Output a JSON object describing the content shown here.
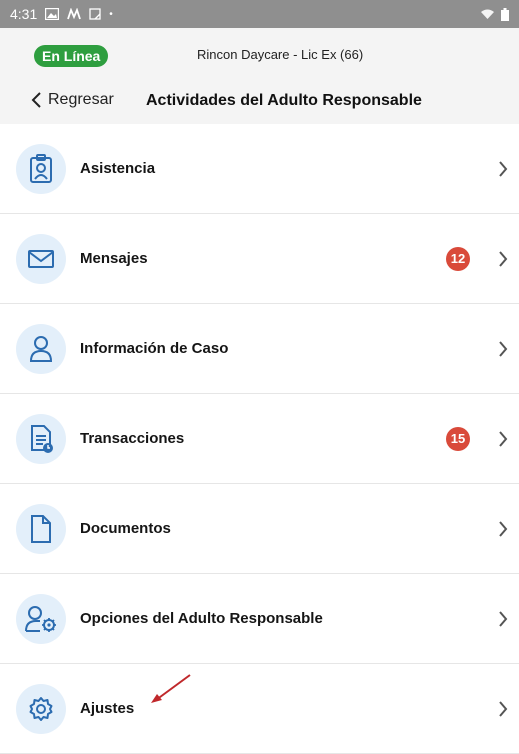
{
  "status_bar": {
    "time": "4:31",
    "left_icons": [
      "gallery-icon",
      "signal-app-icon",
      "screenshot-icon"
    ],
    "right_icons": [
      "wifi-icon",
      "battery-icon"
    ]
  },
  "header": {
    "online_label": "En Línea",
    "provider": "Rincon Daycare - Lic Ex (66)",
    "back_label": "Regresar",
    "title": "Actividades del Adulto Responsable"
  },
  "menu": [
    {
      "label": "Asistencia",
      "icon": "badge-id-icon",
      "badge": ""
    },
    {
      "label": "Mensajes",
      "icon": "envelope-icon",
      "badge": "12"
    },
    {
      "label": "Información de Caso",
      "icon": "person-icon",
      "badge": ""
    },
    {
      "label": "Transacciones",
      "icon": "document-clock-icon",
      "badge": "15"
    },
    {
      "label": "Documentos",
      "icon": "file-icon",
      "badge": ""
    },
    {
      "label": "Opciones del Adulto Responsable",
      "icon": "person-gear-icon",
      "badge": ""
    },
    {
      "label": "Ajustes",
      "icon": "gear-icon",
      "badge": ""
    }
  ],
  "colors": {
    "online": "#2e9e3f",
    "badge": "#d94a3a",
    "icon_bg": "#e3effa",
    "icon_stroke": "#2c6cb0"
  }
}
